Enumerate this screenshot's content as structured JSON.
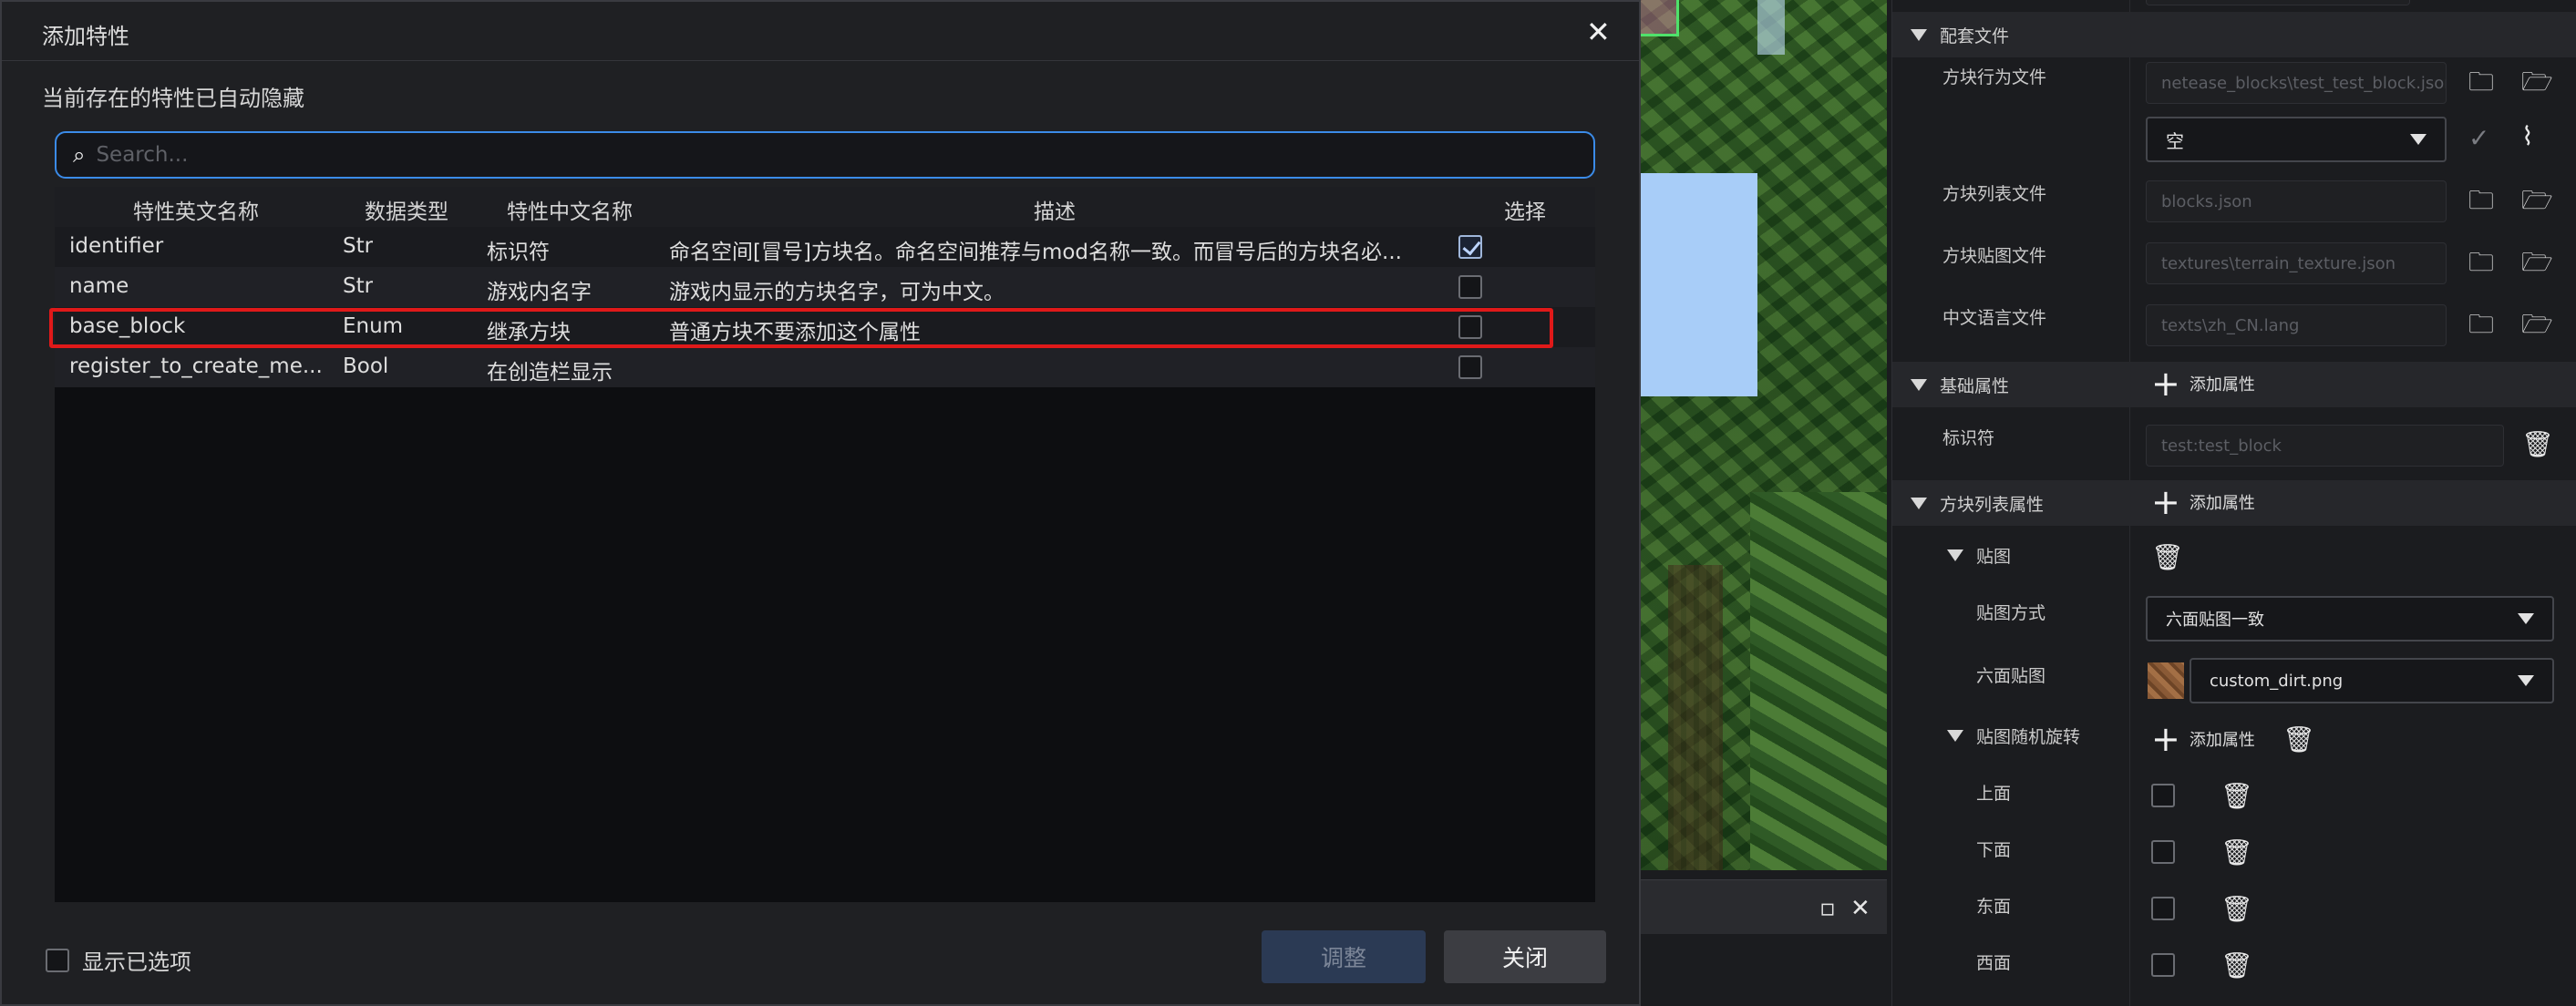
{
  "dialog": {
    "title": "添加特性",
    "hint": "当前存在的特性已自动隐藏",
    "search_placeholder": "Search...",
    "columns": [
      "特性英文名称",
      "数据类型",
      "特性中文名称",
      "描述",
      "选择"
    ],
    "rows": [
      {
        "en": "identifier",
        "type": "Str",
        "cn": "标识符",
        "desc": "命名空间[冒号]方块名。命名空间推荐与mod名称一致。而冒号后的方块名必...",
        "checked": true
      },
      {
        "en": "name",
        "type": "Str",
        "cn": "游戏内名字",
        "desc": "游戏内显示的方块名字，可为中文。",
        "checked": false
      },
      {
        "en": "base_block",
        "type": "Enum",
        "cn": "继承方块",
        "desc": "普通方块不要添加这个属性",
        "checked": false
      },
      {
        "en": "register_to_create_me...",
        "type": "Bool",
        "cn": "在创造栏显示",
        "desc": "",
        "checked": false
      }
    ],
    "show_selected_label": "显示已选项",
    "adjust_label": "调整",
    "close_label": "关闭"
  },
  "panel": {
    "config_files": {
      "title": "配套文件",
      "behavior_label": "方块行为文件",
      "behavior_value": "netease_blocks\\test_test_block.json",
      "behavior_select": "空",
      "list_label": "方块列表文件",
      "list_value": "blocks.json",
      "texture_label": "方块贴图文件",
      "texture_value": "textures\\terrain_texture.json",
      "lang_label": "中文语言文件",
      "lang_value": "texts\\zh_CN.lang"
    },
    "basic": {
      "title": "基础属性",
      "add_label": "添加属性",
      "identifier_label": "标识符",
      "identifier_value": "test:test_block"
    },
    "list_props": {
      "title": "方块列表属性",
      "add_label": "添加属性",
      "texture_group": "贴图",
      "texture_mode_label": "贴图方式",
      "texture_mode_value": "六面贴图一致",
      "six_face_label": "六面贴图",
      "six_face_value": "custom_dirt.png",
      "random_rotation": "贴图随机旋转",
      "random_add_label": "添加属性",
      "faces": [
        "上面",
        "下面",
        "东面",
        "西面"
      ]
    }
  },
  "icons": {
    "close": "close-icon",
    "search": "search-icon",
    "folder_locate": "folder-locate-icon",
    "folder_open": "folder-open-icon",
    "trash": "trash-icon",
    "check_circle": "check-circle-icon",
    "broom": "broom-icon",
    "plus": "plus-icon",
    "maximize": "maximize-icon"
  },
  "colors": {
    "accent": "#3b8be8",
    "highlight": "#e01919",
    "dialog_bg": "#1f2023"
  }
}
